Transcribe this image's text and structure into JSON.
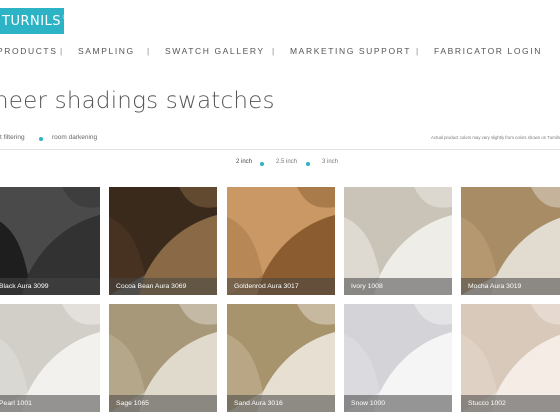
{
  "brand": {
    "logo_text": "TURNILS",
    "logo_mark": "®",
    "accent": "#2cb3c6"
  },
  "nav": {
    "items": [
      {
        "label": "PRODUCTS"
      },
      {
        "label": "SAMPLING"
      },
      {
        "label": "SWATCH GALLERY"
      },
      {
        "label": "MARKETING SUPPORT"
      },
      {
        "label": "FABRICATOR LOGIN"
      }
    ],
    "separator": "|"
  },
  "page": {
    "title": "heer shadings swatches"
  },
  "filters": {
    "options": [
      {
        "label": "t filtering"
      },
      {
        "label": "room darkening"
      }
    ],
    "disclaimer": "Actual product colors may vary slightly from colors shown on Turnils"
  },
  "widths": {
    "options": [
      {
        "label": "2 inch",
        "active": true
      },
      {
        "label": "2.5 inch",
        "active": false
      },
      {
        "label": "3 inch",
        "active": false
      }
    ]
  },
  "swatches": [
    {
      "name": "Black Aura 3099",
      "colors": [
        "#1c1c1c",
        "#4a4a4a",
        "#323232",
        "#161616"
      ]
    },
    {
      "name": "Cocoa Bean Aura 3069",
      "colors": [
        "#5b5751",
        "#3a2a1c",
        "#8a6a46",
        "#4a3222"
      ]
    },
    {
      "name": "Goldenrod Aura 3017",
      "colors": [
        "#a97a4a",
        "#c99864",
        "#8a5c30",
        "#b48452"
      ]
    },
    {
      "name": "Ivory 1008",
      "colors": [
        "#dad7d0",
        "#c9c3b8",
        "#efede8",
        "#e2ded6"
      ]
    },
    {
      "name": "Mocha Aura 3019",
      "colors": [
        "#d4cec6",
        "#a88c66",
        "#e2dbd0",
        "#b89a72"
      ]
    },
    {
      "name": "Pearl 1001",
      "colors": [
        "#e6e4e0",
        "#d2cfc9",
        "#f3f1ee",
        "#dcd9d4"
      ]
    },
    {
      "name": "Sage 1065",
      "colors": [
        "#c6bfb0",
        "#a8987a",
        "#e0dacd",
        "#b7a98c"
      ]
    },
    {
      "name": "Sand Aura 3016",
      "colors": [
        "#d3c9b6",
        "#a7936c",
        "#e7e0d2",
        "#bca98a"
      ]
    },
    {
      "name": "Snow 1000",
      "colors": [
        "#e9e9eb",
        "#d3d3d8",
        "#f5f5f6",
        "#dcdce0"
      ]
    },
    {
      "name": "Stucco 1002",
      "colors": [
        "#e9dfd6",
        "#d8c9bb",
        "#f4ece5",
        "#e0d2c5"
      ]
    }
  ]
}
